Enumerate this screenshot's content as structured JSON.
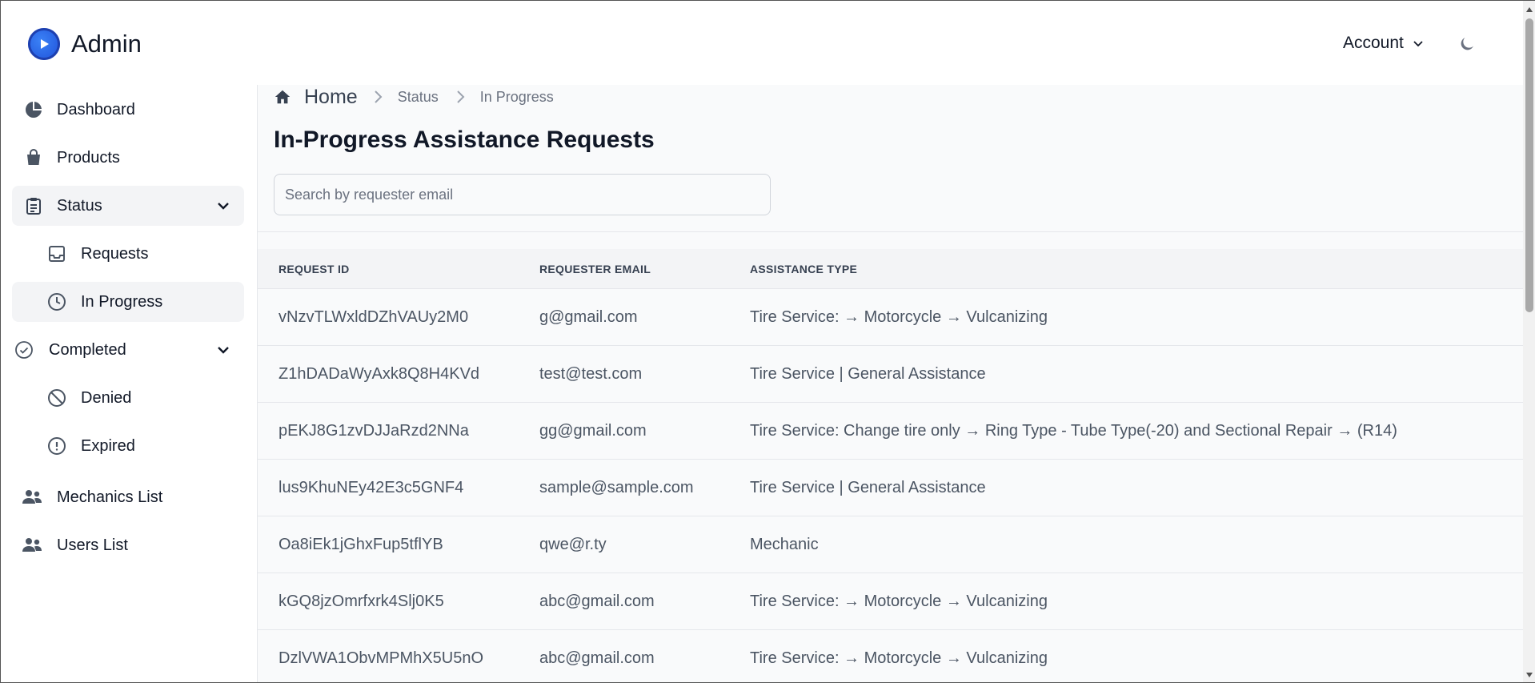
{
  "brand": {
    "name": "Admin"
  },
  "header": {
    "account_label": "Account"
  },
  "sidebar": {
    "items": [
      {
        "label": "Dashboard",
        "icon": "pie-chart-icon"
      },
      {
        "label": "Products",
        "icon": "shopping-bag-icon"
      },
      {
        "label": "Status",
        "icon": "clipboard-icon",
        "expanded": true
      },
      {
        "label": "Requests",
        "icon": "inbox-icon"
      },
      {
        "label": "In Progress",
        "icon": "clock-icon",
        "active": true
      },
      {
        "label": "Completed",
        "icon": "check-circle-icon",
        "expanded": true
      },
      {
        "label": "Denied",
        "icon": "ban-icon"
      },
      {
        "label": "Expired",
        "icon": "exclamation-circle-icon"
      },
      {
        "label": "Mechanics List",
        "icon": "users-icon"
      },
      {
        "label": "Users List",
        "icon": "users-icon"
      }
    ]
  },
  "breadcrumb": {
    "home": "Home",
    "level1": "Status",
    "level2": "In Progress"
  },
  "main": {
    "title": "In-Progress Assistance Requests",
    "search_placeholder": "Search by requester email"
  },
  "table": {
    "headers": [
      "REQUEST ID",
      "REQUESTER EMAIL",
      "ASSISTANCE TYPE"
    ],
    "rows": [
      [
        "vNzvTLWxldDZhVAUy2M0",
        "g@gmail.com",
        "Tire Service: → Motorcycle → Vulcanizing"
      ],
      [
        "Z1hDADaWyAxk8Q8H4KVd",
        "test@test.com",
        "Tire Service | General Assistance"
      ],
      [
        "pEKJ8G1zvDJJaRzd2NNa",
        "gg@gmail.com",
        "Tire Service: Change tire only → Ring Type - Tube Type(-20) and Sectional Repair → (R14)"
      ],
      [
        "lus9KhuNEy42E3c5GNF4",
        "sample@sample.com",
        "Tire Service | General Assistance"
      ],
      [
        "Oa8iEk1jGhxFup5tflYB",
        "qwe@r.ty",
        "Mechanic"
      ],
      [
        "kGQ8jzOmrfxrk4Slj0K5",
        "abc@gmail.com",
        "Tire Service: → Motorcycle → Vulcanizing"
      ],
      [
        "DzlVWA1ObvMPMhX5U5nO",
        "abc@gmail.com",
        "Tire Service: → Motorcycle → Vulcanizing"
      ]
    ]
  },
  "colors": {
    "brand_blue": "#1d4ed8",
    "active_bg": "#f3f4f6",
    "main_bg": "#f9fafb"
  }
}
